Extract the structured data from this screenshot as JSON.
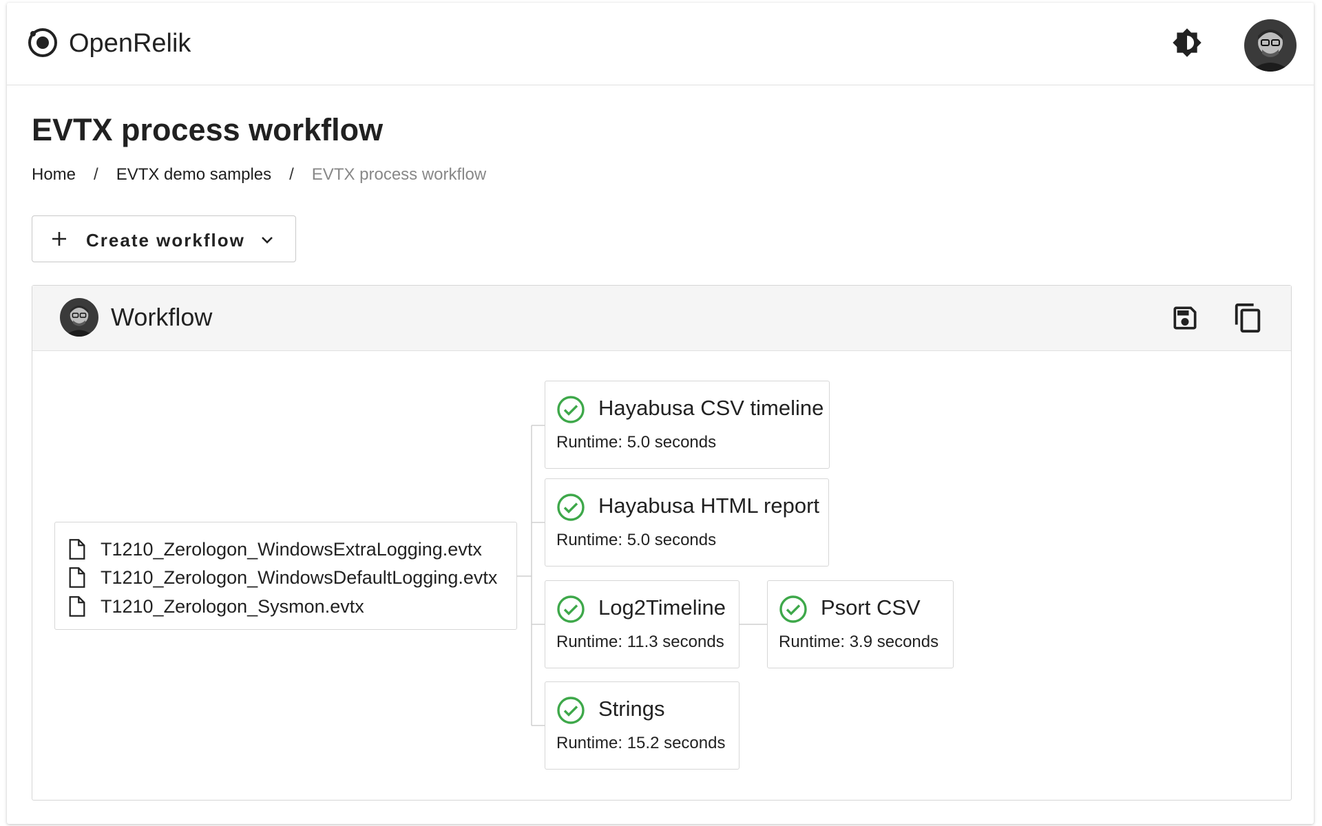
{
  "app": {
    "brand": "OpenRelik"
  },
  "page": {
    "title": "EVTX process workflow",
    "breadcrumb": [
      "Home",
      "EVTX demo samples",
      "EVTX process workflow"
    ]
  },
  "actions": {
    "create_workflow_label": "Create workflow"
  },
  "workflow": {
    "title": "Workflow",
    "files": [
      "T1210_Zerologon_WindowsExtraLogging.evtx",
      "T1210_Zerologon_WindowsDefaultLogging.evtx",
      "T1210_Zerologon_Sysmon.evtx"
    ],
    "tasks": [
      {
        "name": "Hayabusa CSV timeline",
        "runtime": "Runtime: 5.0 seconds",
        "status": "success"
      },
      {
        "name": "Hayabusa HTML report",
        "runtime": "Runtime: 5.0 seconds",
        "status": "success"
      },
      {
        "name": "Log2Timeline",
        "runtime": "Runtime: 11.3 seconds",
        "status": "success"
      },
      {
        "name": "Psort CSV",
        "runtime": "Runtime: 3.9 seconds",
        "status": "success"
      },
      {
        "name": "Strings",
        "runtime": "Runtime: 15.2 seconds",
        "status": "success"
      }
    ]
  },
  "colors": {
    "success": "#3ea84a",
    "header_bg": "#f5f5f5",
    "border": "#d6d6d6"
  },
  "icons": {
    "logo": "openrelik-logo-icon",
    "theme": "brightness-contrast-icon",
    "save": "save-icon",
    "copy": "copy-icon",
    "file": "file-icon",
    "check": "check-circle-icon"
  }
}
